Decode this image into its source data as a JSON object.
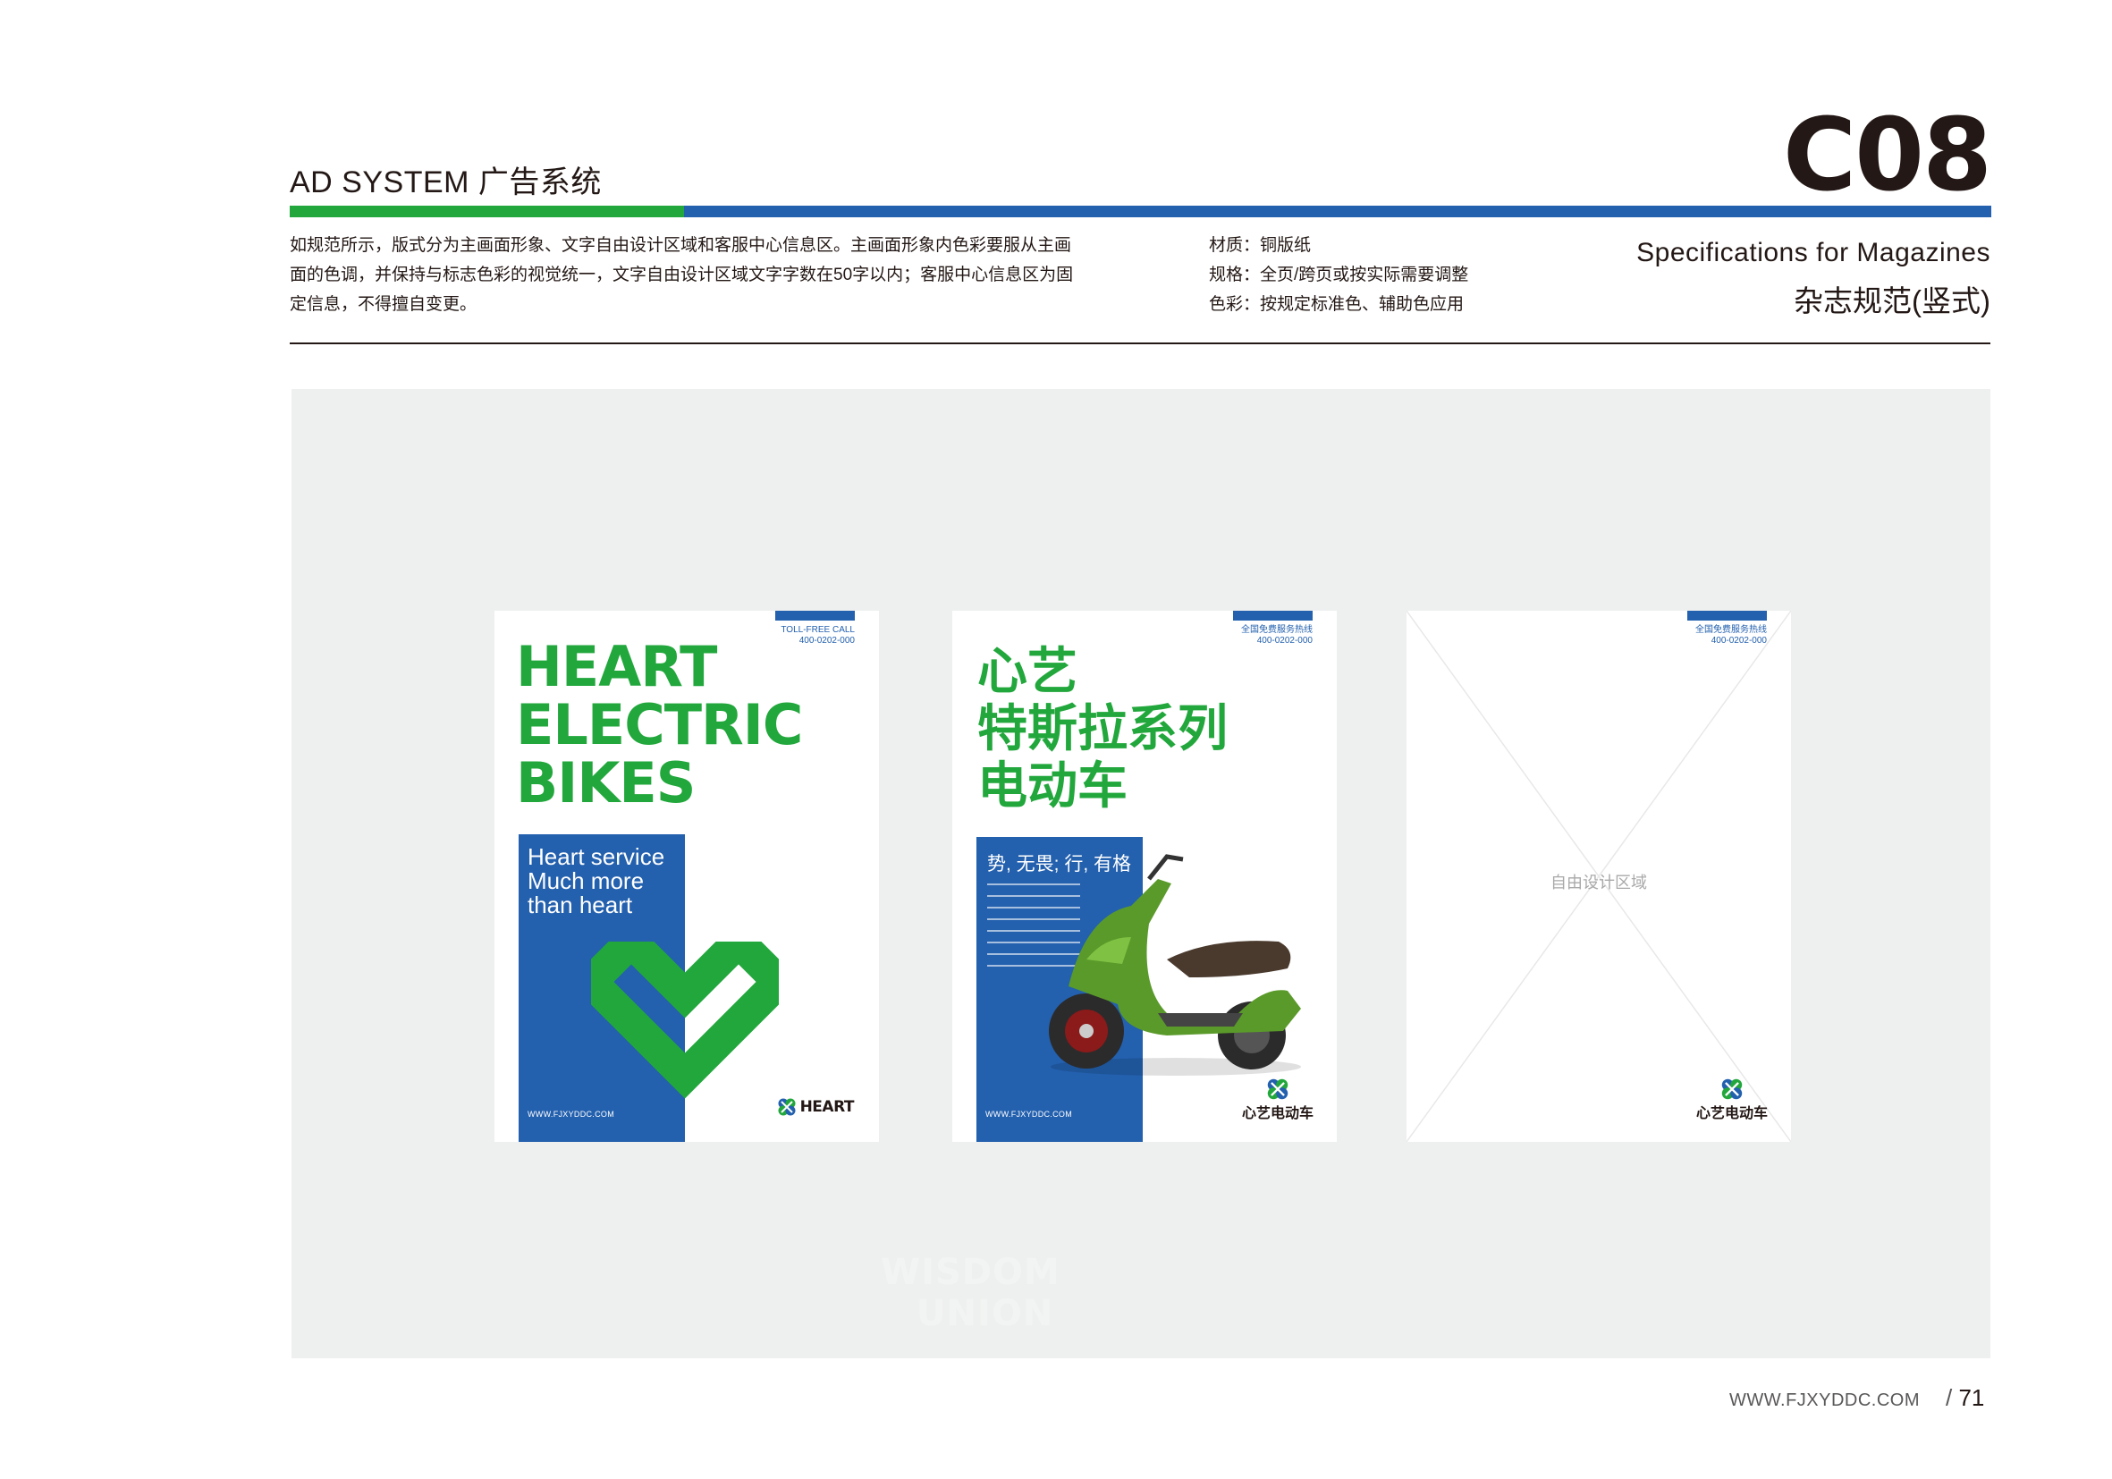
{
  "header": {
    "title": "AD SYSTEM 广告系统",
    "code": "C08",
    "subtitle_en": "Specifications for  Magazines",
    "subtitle_cn": "杂志规范(竖式)"
  },
  "description": "如规范所示，版式分为主画面形象、文字自由设计区域和客服中心信息区。主画面形象内色彩要服从主画面的色调，并保持与标志色彩的视觉统一，文字自由设计区域文字字数在50字以内；客服中心信息区为固定信息，不得擅自变更。",
  "specs": [
    "材质：铜版纸",
    "规格：全页/跨页或按实际需要调整",
    "色彩：按规定标准色、辅助色应用"
  ],
  "magazines": {
    "en": {
      "hotline_label": "TOLL-FREE CALL",
      "hotline_number": "400-0202-000",
      "headline": [
        "HEART",
        "ELECTRIC",
        "BIKES"
      ],
      "slogan": [
        "Heart service",
        "Much more",
        "than heart"
      ],
      "url": "WWW.FJXYDDC.COM",
      "brand": "HEART"
    },
    "cn": {
      "hotline_label": "全国免费服务热线",
      "hotline_number": "400-0202-000",
      "headline": [
        "心艺",
        "特斯拉系列",
        "电动车"
      ],
      "slogan": "势, 无畏; 行, 有格",
      "url": "WWW.FJXYDDC.COM",
      "brand": "心艺电动车"
    },
    "template": {
      "hotline_label": "全国免费服务热线",
      "hotline_number": "400-0202-000",
      "placeholder": "自由设计区域",
      "brand": "心艺电动车"
    }
  },
  "watermark": {
    "line1": "WISDOM",
    "line2": "UNION"
  },
  "footer": {
    "url": "WWW.FJXYDDC.COM",
    "page": "71"
  },
  "colors": {
    "brand_green": "#22a73c",
    "brand_blue": "#2360ae",
    "stage_gray": "#eef0ef"
  }
}
